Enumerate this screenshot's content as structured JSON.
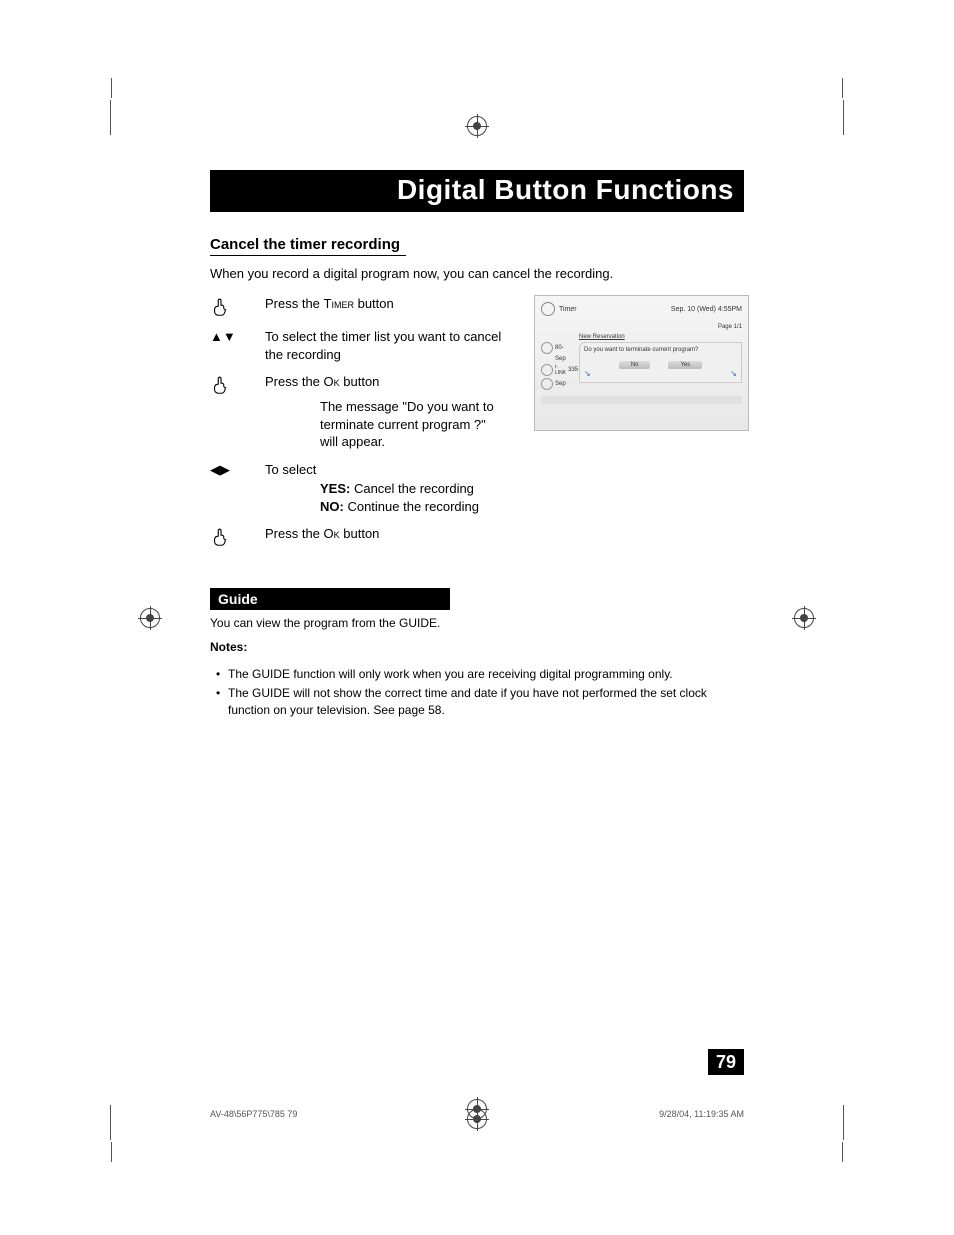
{
  "header": "Digital Button Functions",
  "section1": {
    "title": "Cancel the timer recording",
    "intro": "When you record a digital program now, you can cancel the recording.",
    "steps": {
      "s1": {
        "pre": "Press the ",
        "btn": "Timer",
        "post": " button"
      },
      "s2": "To select the timer list you want to cancel the recording",
      "s3": {
        "pre": "Press the ",
        "btn": "Ok",
        "post": " button"
      },
      "s3msg": "The message \"Do you want to terminate current program ?\" will appear.",
      "s4": "To select",
      "s4yes_lbl": "YES:",
      "s4yes": "  Cancel the recording",
      "s4no_lbl": "NO:",
      "s4no": "  Continue the recording",
      "s5": {
        "pre": "Press the ",
        "btn": "Ok",
        "post": " button"
      }
    }
  },
  "fig": {
    "title": "Timer",
    "date": "Sep. 10 (Wed)    4:55PM",
    "page": "Page 1/1",
    "newres": "New Reservation",
    "side": {
      "r1": "80-",
      "r2": "Sep",
      "r3": "335",
      "r4": "Sep",
      "ilink": "i-LINK"
    },
    "question": "Do you want to terminate current program?",
    "no": "No",
    "yes": "Yes"
  },
  "section2": {
    "bar": "Guide",
    "intro": "You can view the program from the GUIDE.",
    "notes_title": "Notes:",
    "notes": [
      "The GUIDE function will only work when you are receiving digital programming only.",
      "The GUIDE will not show the correct time and date if you have not performed the set clock function on your television.  See page 58."
    ]
  },
  "page_number": "79",
  "footer": {
    "left": "AV-48\\56P775\\785   79",
    "right": "9/28/04, 11:19:35 AM"
  },
  "glyphs": {
    "ud": "▲▼",
    "lr": "◀▶"
  }
}
